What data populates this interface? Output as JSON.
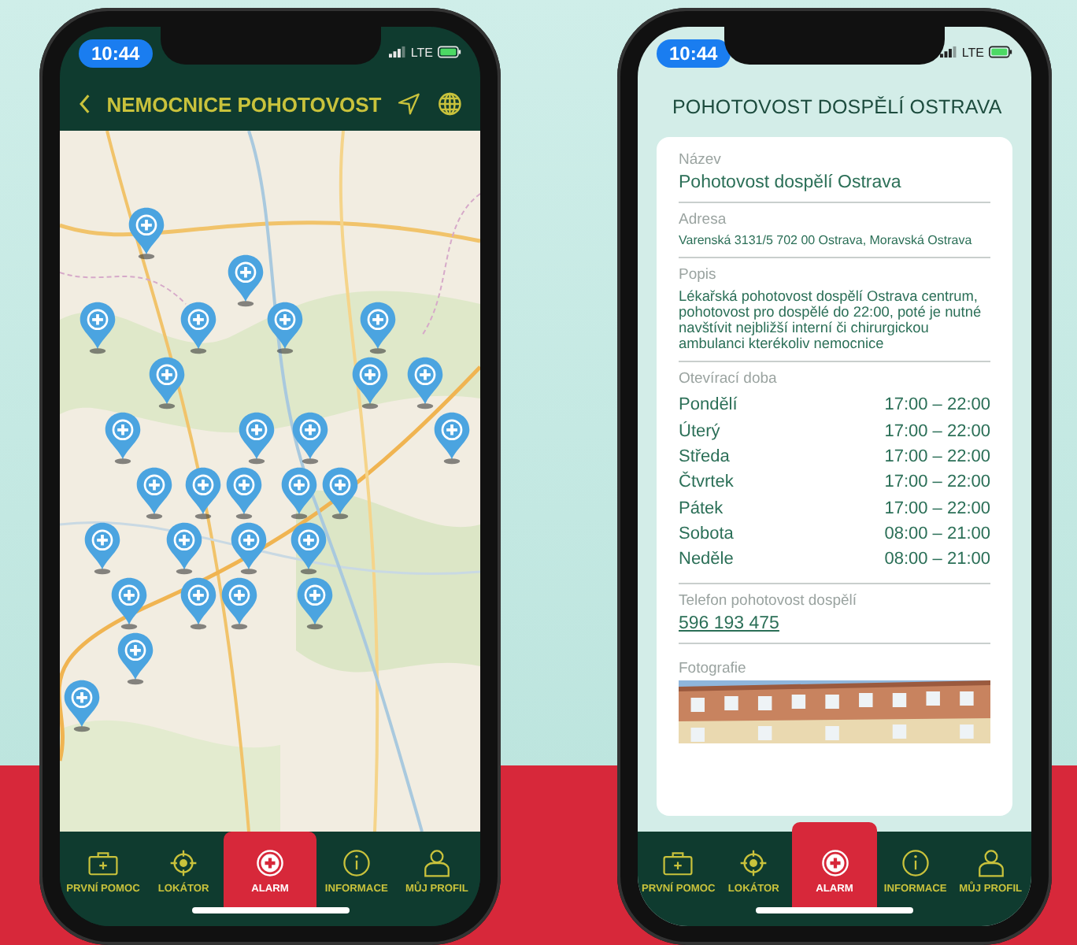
{
  "phones": [
    {
      "kind": "map",
      "status": {
        "time": "10:44",
        "network": "LTE"
      },
      "header": {
        "title": "NEMOCNICE POHOTOVOST"
      },
      "map": {
        "kind": "picture"
      },
      "tabs": [
        {
          "label": "PRVNÍ POMOC",
          "selected": false
        },
        {
          "label": "LOKÁTOR",
          "selected": false
        },
        {
          "label": "ALARM",
          "selected": true
        },
        {
          "label": "INFORMACE",
          "selected": false
        },
        {
          "label": "MŮJ PROFIL",
          "selected": false
        }
      ]
    },
    {
      "kind": "detail",
      "status": {
        "time": "10:44",
        "network": "LTE"
      },
      "header": {
        "title": "POHOTOVOST DOSPĚLÍ OSTRAVA"
      },
      "sections": [
        {
          "kind": "text",
          "label": "Název",
          "value": "Pohotovost dospělí Ostrava"
        },
        {
          "kind": "small",
          "label": "Adresa",
          "value": "Varenská 3131/5 702 00 Ostrava, Moravská Ostrava"
        },
        {
          "kind": "paragraph",
          "label": "Popis",
          "value": "Lékařská pohotovost dospělí Ostrava centrum, pohotovost pro dospělé do 22:00, poté je nutné navštívit nejbližší interní či chirurgickou ambulanci kterékoliv nemocnice"
        },
        {
          "kind": "hours",
          "label": "Otevírací doba",
          "hours": [
            {
              "day": "Pondělí",
              "time": "17:00 – 22:00"
            },
            {
              "day": "Úterý",
              "time": "17:00 – 22:00"
            },
            {
              "day": "Středa",
              "time": "17:00 – 22:00"
            },
            {
              "day": "Čtvrtek",
              "time": "17:00 – 22:00"
            },
            {
              "day": "Pátek",
              "time": "17:00 – 22:00"
            },
            {
              "day": "Sobota",
              "time": "08:00 – 21:00"
            },
            {
              "day": "Neděle",
              "time": "08:00 – 21:00"
            }
          ]
        },
        {
          "kind": "link",
          "label": "Telefon pohotovost dospělí",
          "value": "596 193 475"
        },
        {
          "label": "Fotografie"
        }
      ],
      "tabs": [
        {
          "label": "PRVNÍ POMOC",
          "selected": false
        },
        {
          "label": "LOKÁTOR",
          "selected": false
        },
        {
          "label": "ALARM",
          "selected": true
        },
        {
          "label": "INFORMACE",
          "selected": false
        },
        {
          "label": "MŮJ PROFIL",
          "selected": false
        }
      ]
    }
  ]
}
